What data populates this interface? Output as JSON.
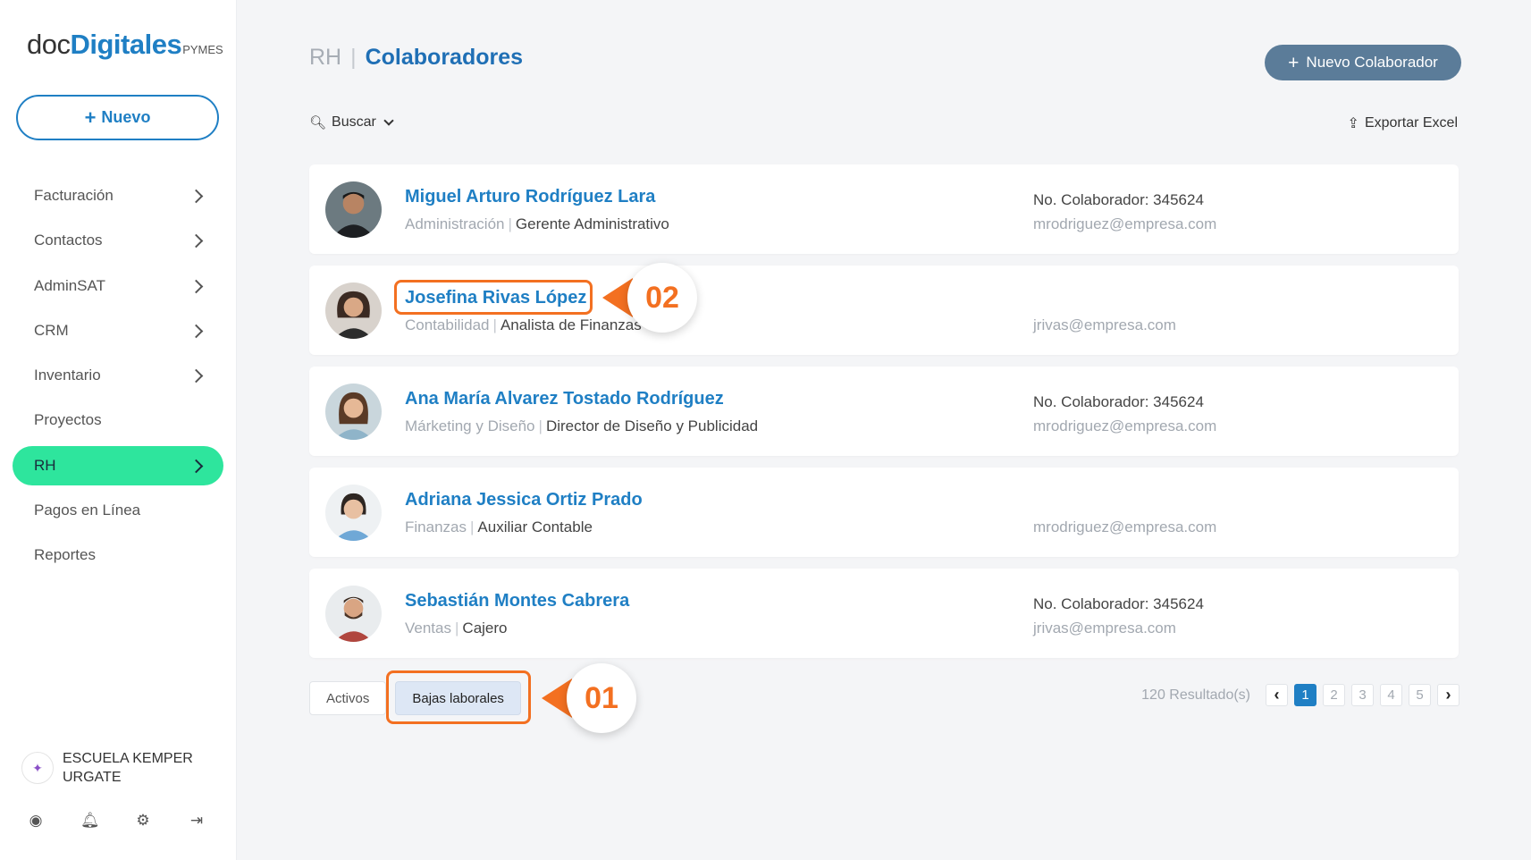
{
  "sidebar": {
    "logo": {
      "part1": "doc",
      "part2": "Digitales",
      "part3": "PYMES"
    },
    "new_button": {
      "icon": "plus-icon",
      "label": "Nuevo"
    },
    "items": [
      {
        "label": "Facturación",
        "chevron": true
      },
      {
        "label": "Contactos",
        "chevron": true
      },
      {
        "label": "AdminSAT",
        "chevron": true
      },
      {
        "label": "CRM",
        "chevron": true
      },
      {
        "label": "Inventario",
        "chevron": true
      },
      {
        "label": "Proyectos",
        "chevron": false
      },
      {
        "label": "RH",
        "chevron": true,
        "active": true
      },
      {
        "label": "Pagos en Línea",
        "chevron": false
      },
      {
        "label": "Reportes",
        "chevron": false
      }
    ],
    "org": {
      "name_line1": "ESCUELA KEMPER",
      "name_line2": "URGATE"
    },
    "bottom_icons": [
      "user-circle-icon",
      "bell-icon",
      "gear-icon",
      "logout-icon"
    ]
  },
  "header": {
    "root": "RH",
    "separator": "|",
    "current": "Colaboradores",
    "new_button": "Nuevo Colaborador"
  },
  "toolbar": {
    "search_label": "Buscar",
    "export_label": "Exportar Excel"
  },
  "collaborators": [
    {
      "name": "Miguel Arturo Rodríguez Lara",
      "department": "Administración",
      "role": "Gerente Administrativo",
      "number": "No. Colaborador: 345624",
      "email": "mrodriguez@empresa.com"
    },
    {
      "name": "Josefina Rivas López",
      "department": "Contabilidad",
      "role": "Analista de Finanzas",
      "number": "",
      "email": "jrivas@empresa.com"
    },
    {
      "name": "Ana María Alvarez Tostado Rodríguez",
      "department": "Márketing y Diseño",
      "role": "Director de Diseño y Publicidad",
      "number": "No. Colaborador: 345624",
      "email": "mrodriguez@empresa.com"
    },
    {
      "name": "Adriana Jessica Ortiz Prado",
      "department": "Finanzas",
      "role": "Auxiliar Contable",
      "number": "",
      "email": "mrodriguez@empresa.com"
    },
    {
      "name": "Sebastián Montes Cabrera",
      "department": "Ventas",
      "role": "Cajero",
      "number": "No. Colaborador: 345624",
      "email": "jrivas@empresa.com"
    }
  ],
  "tabs": {
    "active": "Activos",
    "inactive": "Bajas laborales"
  },
  "pagination": {
    "results": "120 Resultado(s)",
    "pages": [
      "1",
      "2",
      "3",
      "4",
      "5"
    ],
    "current": "1"
  },
  "annotations": {
    "callout1": "01",
    "callout2": "02",
    "accent": "#f37021"
  }
}
